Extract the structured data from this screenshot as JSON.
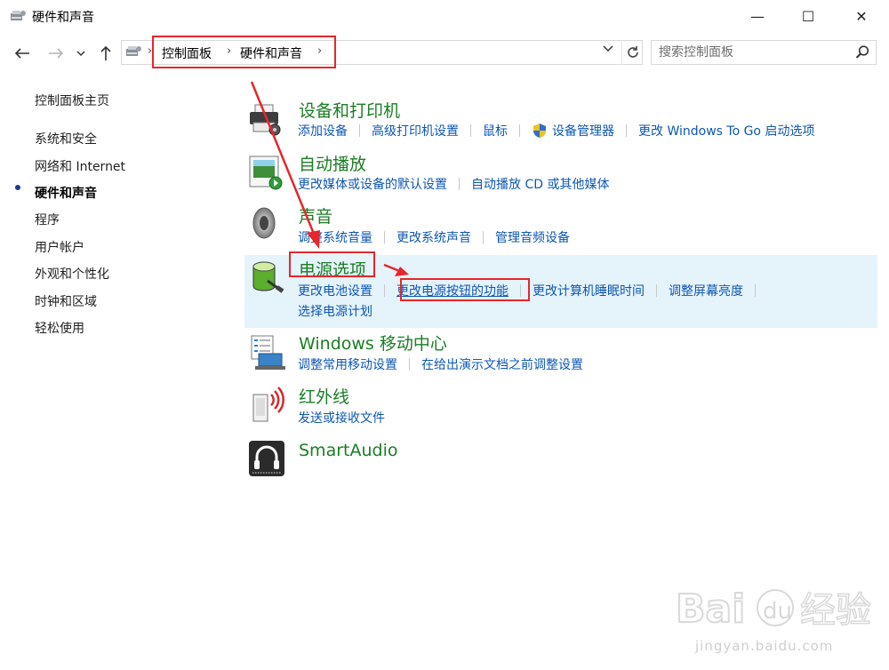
{
  "window": {
    "title": "硬件和声音",
    "controls": {
      "minimize": "—",
      "maximize": "☐",
      "close": "✕"
    }
  },
  "address_bar": {
    "breadcrumbs": [
      "控制面板",
      "硬件和声音"
    ],
    "separator": "›",
    "search_placeholder": "搜索控制面板"
  },
  "sidebar": {
    "home": "控制面板主页",
    "items": [
      {
        "label": "系统和安全",
        "active": false
      },
      {
        "label": "网络和 Internet",
        "active": false
      },
      {
        "label": "硬件和声音",
        "active": true
      },
      {
        "label": "程序",
        "active": false
      },
      {
        "label": "用户帐户",
        "active": false
      },
      {
        "label": "外观和个性化",
        "active": false
      },
      {
        "label": "时钟和区域",
        "active": false
      },
      {
        "label": "轻松使用",
        "active": false
      }
    ]
  },
  "categories": [
    {
      "title": "设备和打印机",
      "icon": "printer-icon",
      "links": [
        "添加设备",
        "高级打印机设置",
        "鼠标",
        "设备管理器",
        "更改 Windows To Go 启动选项"
      ]
    },
    {
      "title": "自动播放",
      "icon": "autoplay-icon",
      "links": [
        "更改媒体或设备的默认设置",
        "自动播放 CD 或其他媒体"
      ]
    },
    {
      "title": "声音",
      "icon": "speaker-icon",
      "links": [
        "调整系统音量",
        "更改系统声音",
        "管理音频设备"
      ]
    },
    {
      "title": "电源选项",
      "icon": "battery-icon",
      "links": [
        "更改电池设置",
        "更改电源按钮的功能",
        "更改计算机睡眠时间",
        "调整屏幕亮度",
        "选择电源计划"
      ]
    },
    {
      "title": "Windows 移动中心",
      "icon": "mobility-center-icon",
      "links": [
        "调整常用移动设置",
        "在给出演示文档之前调整设置"
      ]
    },
    {
      "title": "红外线",
      "icon": "infrared-icon",
      "links": [
        "发送或接收文件"
      ]
    },
    {
      "title": "SmartAudio",
      "icon": "smartaudio-icon",
      "links": []
    }
  ],
  "colors": {
    "category_title": "#1b7e24",
    "link": "#0d57b3",
    "highlight_row": "#e5f3fb",
    "annotation_red": "#e8262b"
  },
  "watermark": {
    "logo": "Bai du 经验",
    "url": "jingyan.baidu.com"
  }
}
